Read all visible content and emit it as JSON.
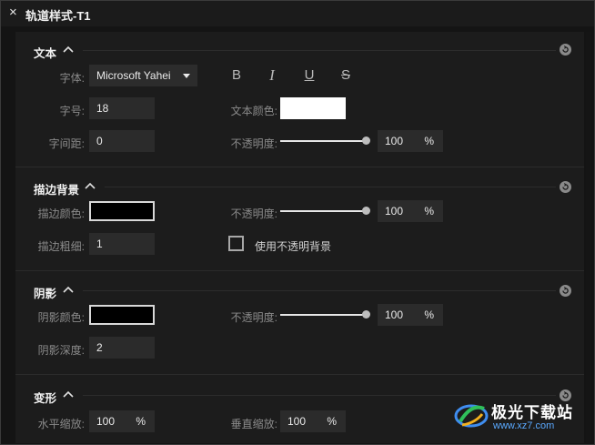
{
  "window": {
    "close_glyph": "×",
    "title": "轨道样式-T1"
  },
  "text_section": {
    "title": "文本",
    "font_label": "字体:",
    "font_value": "Microsoft Yahei",
    "bold": "B",
    "italic": "I",
    "underline": "U",
    "strike": "S",
    "size_label": "字号:",
    "size_value": "18",
    "color_label": "文本颜色:",
    "color": "#ffffff",
    "spacing_label": "字间距:",
    "spacing_value": "0",
    "opacity_label": "不透明度:",
    "opacity_value": "100",
    "opacity_unit": "%",
    "opacity_level": 1.0
  },
  "stroke_section": {
    "title": "描边背景",
    "color_label": "描边颜色:",
    "color": "#000000",
    "opacity_label": "不透明度:",
    "opacity_value": "100",
    "opacity_unit": "%",
    "opacity_level": 1.0,
    "width_label": "描边粗细:",
    "width_value": "1",
    "opaque_bg_label": "使用不透明背景",
    "opaque_bg_checked": false
  },
  "shadow_section": {
    "title": "阴影",
    "color_label": "阴影颜色:",
    "color": "#000000",
    "opacity_label": "不透明度:",
    "opacity_value": "100",
    "opacity_unit": "%",
    "opacity_level": 1.0,
    "depth_label": "阴影深度:",
    "depth_value": "2"
  },
  "transform_section": {
    "title": "变形",
    "hscale_label": "水平缩放:",
    "hscale_value": "100",
    "hscale_unit": "%",
    "vscale_label": "垂直缩放:",
    "vscale_value": "100",
    "vscale_unit": "%"
  },
  "watermark": {
    "name": "极光下载站",
    "url": "www.xz7.com"
  },
  "icons": {
    "collapse": "chevron-up-icon",
    "reset": "reset-icon",
    "close": "close-icon"
  }
}
